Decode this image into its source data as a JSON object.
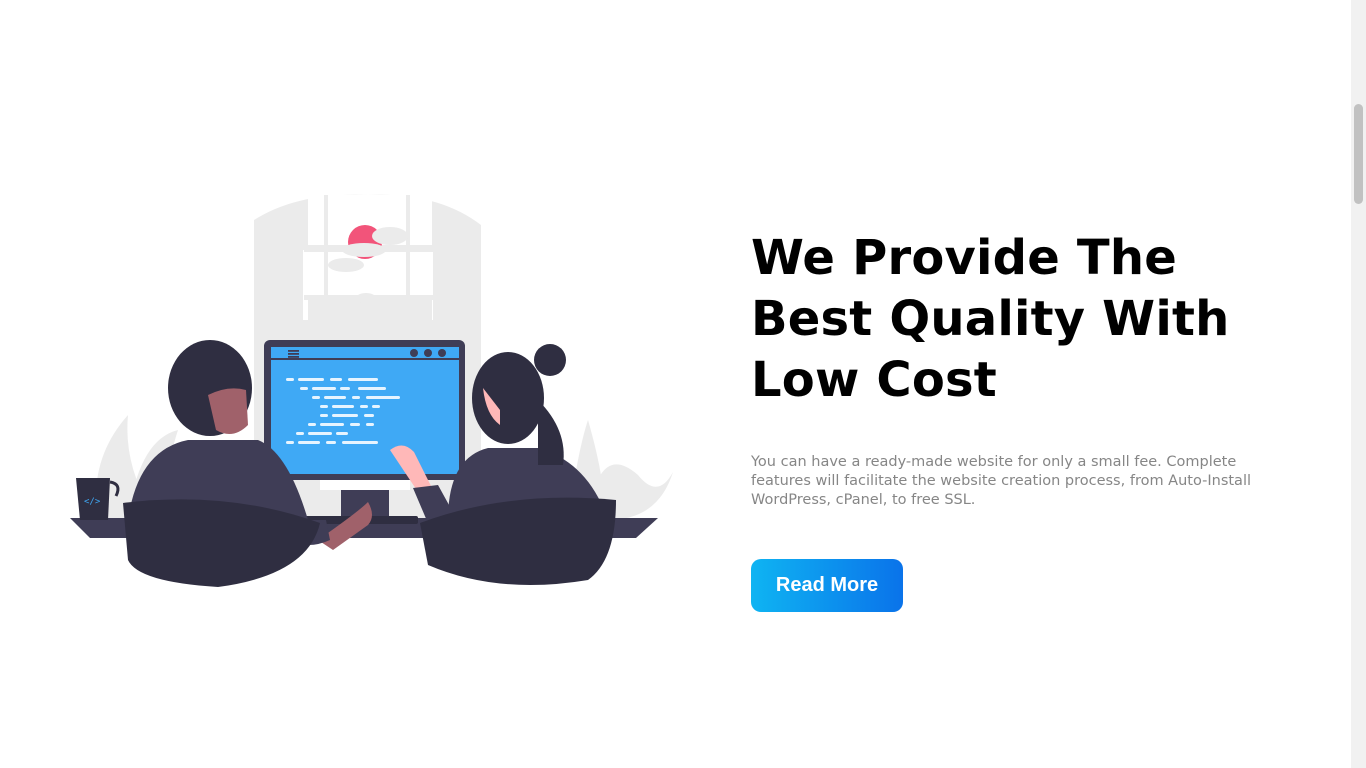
{
  "hero": {
    "headline": "We Provide The Best Quality With Low Cost",
    "description": "You can have a ready-made website for only a small fee. Complete features will facilitate the website creation process, from Auto-Install WordPress, cPanel, to free SSL.",
    "cta_label": "Read More",
    "illustration_icon": "team-working-at-computer-illustration",
    "code_mug_label": "</>"
  },
  "colors": {
    "accent_start": "#0fb4f2",
    "accent_end": "#0a73ea",
    "heading": "#000000",
    "body_text": "#868686",
    "monitor_screen": "#3fa9f5",
    "sun": "#f2547a",
    "dark_figure": "#2f2e41"
  }
}
